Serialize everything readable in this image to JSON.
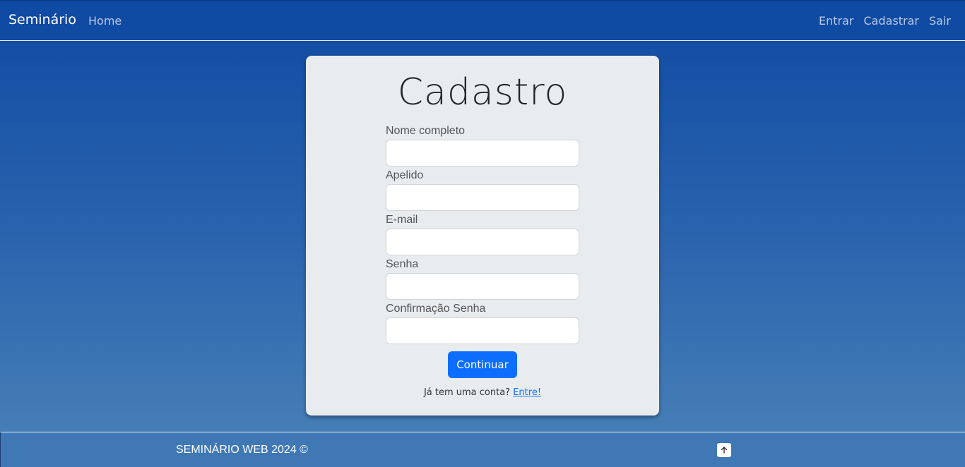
{
  "navbar": {
    "brand": "Seminário",
    "home": "Home",
    "right": [
      "Entrar",
      "Cadastrar",
      "Sair"
    ]
  },
  "card": {
    "title": "Cadastro",
    "fields": [
      {
        "label": "Nome completo",
        "value": ""
      },
      {
        "label": "Apelido",
        "value": ""
      },
      {
        "label": "E-mail",
        "value": ""
      },
      {
        "label": "Senha",
        "value": ""
      },
      {
        "label": "Confirmação Senha",
        "value": ""
      }
    ],
    "button": "Continuar",
    "login_prompt": "Já tem uma conta?",
    "login_link": "Entre!"
  },
  "footer": {
    "text": "SEMINÁRIO WEB 2024 ©",
    "top_icon": "arrow-up-icon"
  },
  "colors": {
    "primary": "#0d6efd",
    "navbar": "#0f4aa3",
    "card": "#e9ecef"
  }
}
